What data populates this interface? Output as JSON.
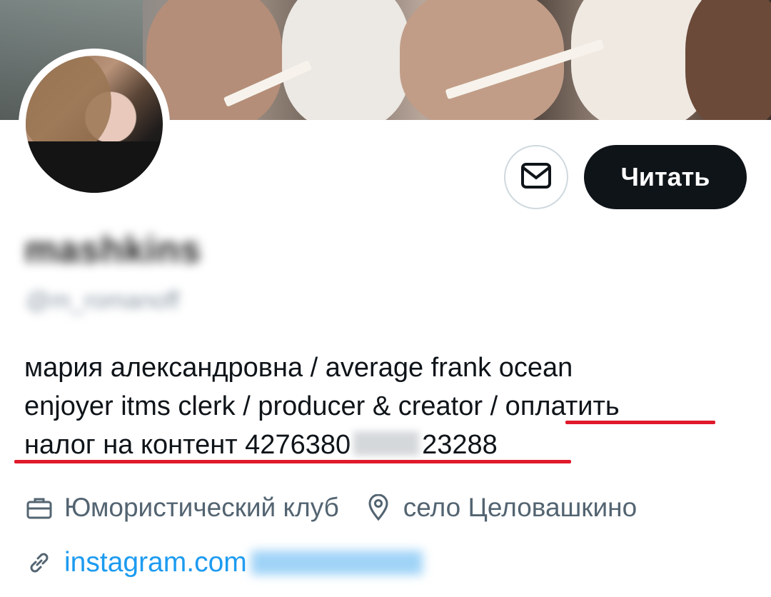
{
  "profile": {
    "banner_alt": "",
    "display_name": "mashkins",
    "handle": "@m_romanoff",
    "bio_lines": [
      "мария александровна / average frank ocean",
      "enjoyer itms clerk / producer & creator / оплатить",
      "налог на контент 4276380",
      "23288"
    ],
    "work": "Юмористический клуб",
    "location": "село Целовашкино",
    "link_prefix": "instagram.com",
    "link_rest": "/marusiaromanoff/"
  },
  "actions": {
    "follow_label": "Читать"
  },
  "icons": {
    "message": "envelope-icon",
    "work": "briefcase-icon",
    "location": "location-pin-icon",
    "link": "link-icon"
  },
  "colors": {
    "accent_link": "#1d9bf0",
    "follow_bg": "#0f1419",
    "underline": "#e0192b",
    "secondary_text": "#536471"
  }
}
